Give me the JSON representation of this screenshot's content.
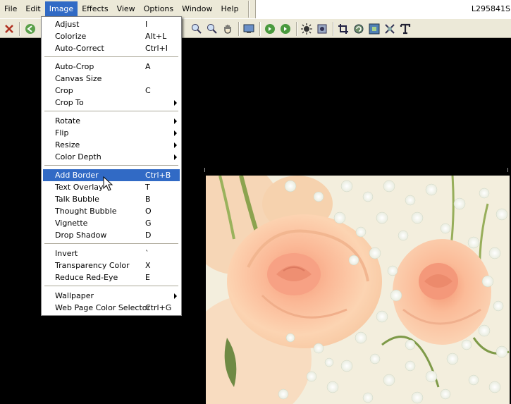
{
  "menubar": {
    "items": [
      "File",
      "Edit",
      "Image",
      "Effects",
      "View",
      "Options",
      "Window",
      "Help"
    ],
    "active": "Image",
    "filename": "L295841S"
  },
  "toolbar": {
    "icons": [
      "close-icon",
      "back-icon",
      "zoom-in-icon",
      "zoom-out-icon",
      "hand-icon",
      "screen-icon",
      "prev-green-icon",
      "next-green-icon",
      "brightness-icon",
      "effects-icon",
      "crop-icon",
      "rotate-icon",
      "resize-icon",
      "transform-icon",
      "text-icon"
    ]
  },
  "image_menu": {
    "items": [
      {
        "label": "Adjust",
        "shortcut": "I"
      },
      {
        "label": "Colorize",
        "shortcut": "Alt+L"
      },
      {
        "label": "Auto-Correct",
        "shortcut": "Ctrl+I"
      },
      {
        "sep": true
      },
      {
        "label": "Auto-Crop",
        "shortcut": "A"
      },
      {
        "label": "Canvas Size",
        "shortcut": ""
      },
      {
        "label": "Crop",
        "shortcut": "C"
      },
      {
        "label": "Crop To",
        "shortcut": "",
        "submenu": true
      },
      {
        "sep": true
      },
      {
        "label": "Rotate",
        "shortcut": "",
        "submenu": true
      },
      {
        "label": "Flip",
        "shortcut": "",
        "submenu": true
      },
      {
        "label": "Resize",
        "shortcut": "",
        "submenu": true
      },
      {
        "label": "Color Depth",
        "shortcut": "",
        "submenu": true
      },
      {
        "sep": true
      },
      {
        "label": "Add Border",
        "shortcut": "Ctrl+B",
        "highlighted": true
      },
      {
        "label": "Text Overlay",
        "shortcut": "T"
      },
      {
        "label": "Talk Bubble",
        "shortcut": "B"
      },
      {
        "label": "Thought Bubble",
        "shortcut": "O"
      },
      {
        "label": "Vignette",
        "shortcut": "G"
      },
      {
        "label": "Drop Shadow",
        "shortcut": "D"
      },
      {
        "sep": true
      },
      {
        "label": "Invert",
        "shortcut": "`"
      },
      {
        "label": "Transparency Color",
        "shortcut": "X"
      },
      {
        "label": "Reduce Red-Eye",
        "shortcut": "E"
      },
      {
        "sep": true
      },
      {
        "label": "Wallpaper",
        "shortcut": "",
        "submenu": true
      },
      {
        "label": "Web Page Color Selector",
        "shortcut": "Ctrl+G"
      }
    ]
  },
  "colors": {
    "highlight": "#316ac5",
    "chrome": "#ece9d8",
    "canvas": "#000000"
  }
}
